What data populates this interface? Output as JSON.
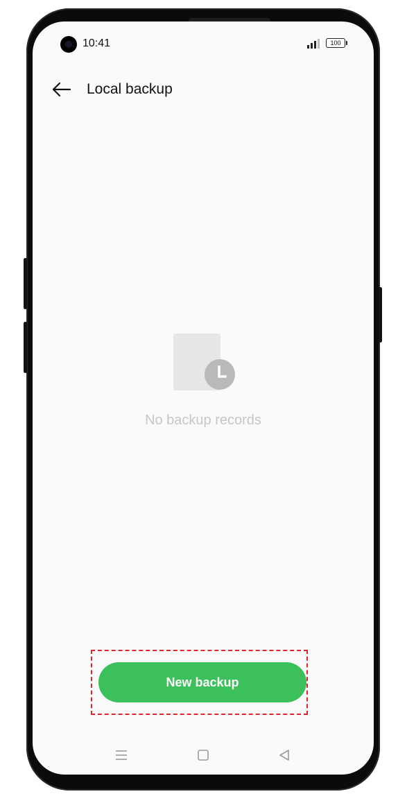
{
  "status_bar": {
    "time": "10:41",
    "battery_level": "100"
  },
  "header": {
    "back_icon": "arrow-left-icon",
    "title": "Local backup"
  },
  "empty_state": {
    "icon": "document-clock-icon",
    "message": "No backup records"
  },
  "actions": {
    "new_backup_label": "New backup"
  },
  "nav_bar": {
    "items": [
      "menu-icon",
      "home-square-icon",
      "back-triangle-icon"
    ]
  },
  "colors": {
    "accent": "#3cc05b",
    "highlight": "#e2232a",
    "background": "#fafafa",
    "empty_text": "#c6c6c6"
  }
}
